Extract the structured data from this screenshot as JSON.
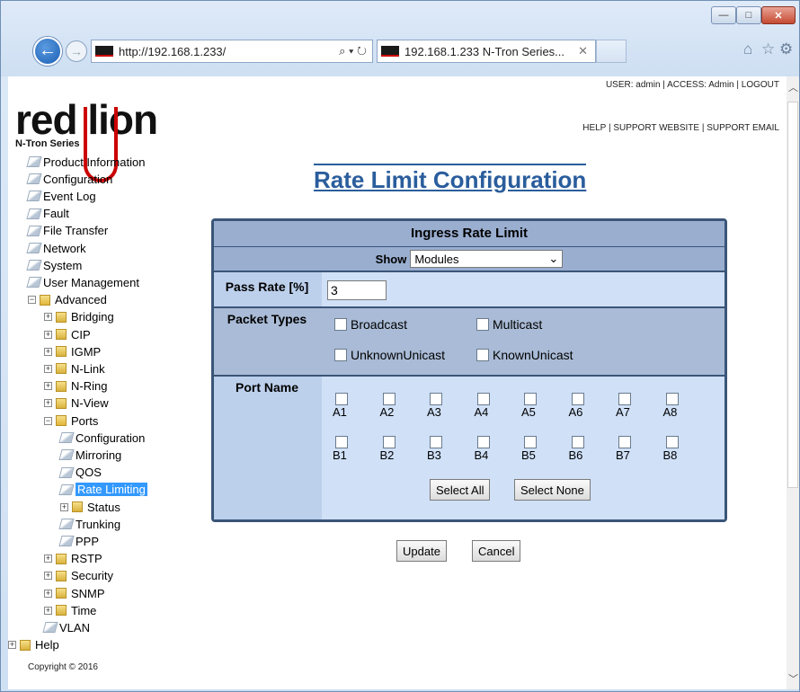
{
  "browser": {
    "url": "http://192.168.1.233/",
    "address_tools": "⌕ ▾ ↻",
    "tab_title": "192.168.1.233 N-Tron Series...",
    "tab_close": "✕",
    "back_icon": "←",
    "forward_icon": "→",
    "minimize": "—",
    "maximize": "□",
    "close": "✕"
  },
  "header": {
    "logo": "red lion",
    "logo_sub": "N-Tron Series",
    "userline": "USER: admin  |  ACCESS: Admin  |  LOGOUT",
    "helpline": "HELP  |  SUPPORT WEBSITE  |  SUPPORT EMAIL"
  },
  "tree": {
    "items": [
      "Product Information",
      "Configuration",
      "Event Log",
      "Fault",
      "File Transfer",
      "Network",
      "System",
      "User Management",
      "Advanced",
      "Bridging",
      "CIP",
      "IGMP",
      "N-Link",
      "N-Ring",
      "N-View",
      "Ports",
      "Configuration",
      "Mirroring",
      "QOS",
      "Rate Limiting",
      "Status",
      "Trunking",
      "PPP",
      "RSTP",
      "Security",
      "SNMP",
      "Time",
      "VLAN",
      "Help"
    ]
  },
  "copyright": "Copyright © 2016",
  "main": {
    "title": "Rate Limit Configuration",
    "table_title": "Ingress Rate Limit",
    "show_label": "Show",
    "show_value": "Modules",
    "pass_rate_label": "Pass Rate [%]",
    "pass_rate_value": "3",
    "packet_types_label": "Packet Types",
    "packet_types": [
      "Broadcast",
      "Multicast",
      "UnknownUnicast",
      "KnownUnicast"
    ],
    "port_name_label": "Port Name",
    "ports_a": [
      "A1",
      "A2",
      "A3",
      "A4",
      "A5",
      "A6",
      "A7",
      "A8"
    ],
    "ports_b": [
      "B1",
      "B2",
      "B3",
      "B4",
      "B5",
      "B6",
      "B7",
      "B8"
    ],
    "select_all": "Select All",
    "select_none": "Select None",
    "update": "Update",
    "cancel": "Cancel"
  }
}
